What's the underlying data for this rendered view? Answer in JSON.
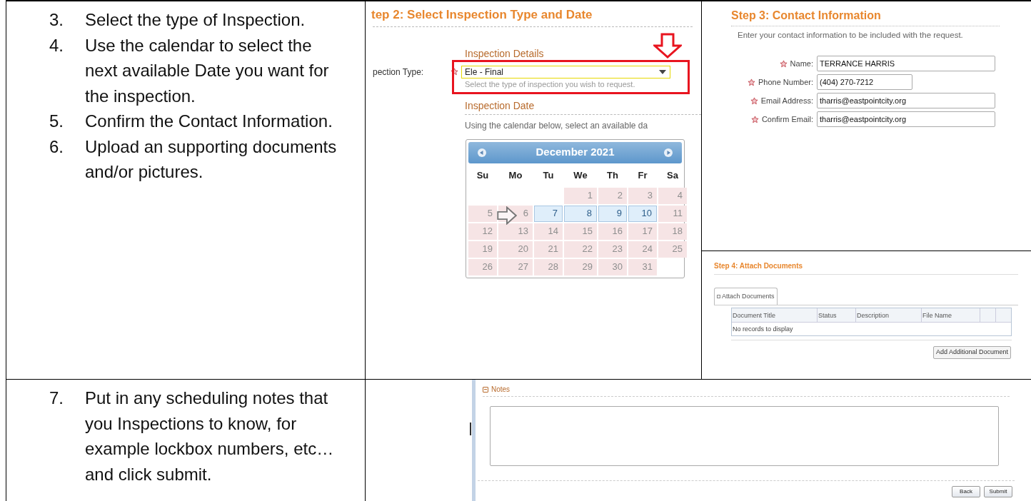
{
  "steps_top": [
    {
      "number": "3.",
      "text": "Select the type of Inspection."
    },
    {
      "number": "4.",
      "text": "Use the calendar to select the next available Date you want for the inspection."
    },
    {
      "number": "5.",
      "text": "Confirm the Contact Information."
    },
    {
      "number": "6.",
      "text": "Upload an supporting documents and/or pictures."
    }
  ],
  "steps_bottom": [
    {
      "number": "7.",
      "text": "Put in any scheduling notes that you Inspections to know, for example lockbox numbers, etc… and click submit."
    }
  ],
  "step2": {
    "title": "tep 2: Select Inspection Type and Date",
    "details_heading": "Inspection Details",
    "type_label": "pection Type:",
    "type_value": "Ele - Final",
    "type_hint": "Select the type of inspection you wish to request.",
    "date_heading": "Inspection Date",
    "date_hint": "Using the calendar below, select an available da",
    "calendar": {
      "month": "December 2021",
      "weekdays": [
        "Su",
        "Mo",
        "Tu",
        "We",
        "Th",
        "Fr",
        "Sa"
      ],
      "weeks": [
        [
          {
            "day": "1",
            "available": false
          },
          {
            "day": "2",
            "available": false
          },
          {
            "day": "3",
            "available": false
          },
          {
            "day": "4",
            "available": false
          }
        ],
        [
          {
            "day": "5",
            "available": false
          },
          {
            "day": "6",
            "available": false
          },
          {
            "day": "7",
            "available": true
          },
          {
            "day": "8",
            "available": true
          },
          {
            "day": "9",
            "available": true
          },
          {
            "day": "10",
            "available": true
          },
          {
            "day": "11",
            "available": false
          }
        ],
        [
          {
            "day": "12",
            "available": false
          },
          {
            "day": "13",
            "available": false
          },
          {
            "day": "14",
            "available": false
          },
          {
            "day": "15",
            "available": false
          },
          {
            "day": "16",
            "available": false
          },
          {
            "day": "17",
            "available": false
          },
          {
            "day": "18",
            "available": false
          }
        ],
        [
          {
            "day": "19",
            "available": false
          },
          {
            "day": "20",
            "available": false
          },
          {
            "day": "21",
            "available": false
          },
          {
            "day": "22",
            "available": false
          },
          {
            "day": "23",
            "available": false
          },
          {
            "day": "24",
            "available": false
          },
          {
            "day": "25",
            "available": false
          }
        ],
        [
          {
            "day": "26",
            "available": false
          },
          {
            "day": "27",
            "available": false
          },
          {
            "day": "28",
            "available": false
          },
          {
            "day": "29",
            "available": false
          },
          {
            "day": "30",
            "available": false
          },
          {
            "day": "31",
            "available": false
          }
        ]
      ]
    }
  },
  "step3": {
    "title": "Step 3: Contact Information",
    "intro": "Enter your contact information to be included with the request.",
    "fields": [
      {
        "label": "Name:",
        "value": "TERRANCE HARRIS",
        "wide": true
      },
      {
        "label": "Phone Number:",
        "value": "(404) 270-7212",
        "wide": false
      },
      {
        "label": "Email Address:",
        "value": "tharris@eastpointcity.org",
        "wide": true
      },
      {
        "label": "Confirm Email:",
        "value": "tharris@eastpointcity.org",
        "wide": true
      }
    ]
  },
  "step4": {
    "title": "Step 4: Attach Documents",
    "tab": {
      "label": "Attach Documents",
      "selected": true
    },
    "columns": [
      "Document Title",
      "Status",
      "Description",
      "File Name"
    ],
    "empty_message": "No records to display",
    "button": "Add Additional Document"
  },
  "notes": {
    "heading": "Notes",
    "expanded": true,
    "buttons": [
      "Back",
      "Submit"
    ]
  }
}
